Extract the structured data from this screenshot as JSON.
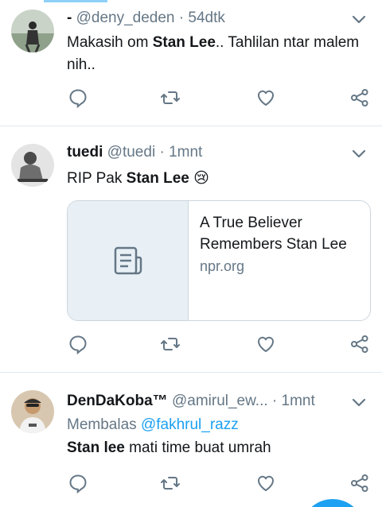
{
  "tweets": [
    {
      "prefix": "-",
      "name": "",
      "handle": "@deny_deden",
      "separator": "·",
      "time": "54dtk",
      "text_before": "Makasih om ",
      "text_bold": "Stan Lee",
      "text_after": ".. Tahlilan ntar malem nih..",
      "avatar_icon": "person-avatar"
    },
    {
      "name": "tuedi",
      "handle": "@tuedi",
      "separator": "·",
      "time": "1mnt",
      "text_before": "RIP Pak ",
      "text_bold": "Stan Lee",
      "text_after": " 😢",
      "card": {
        "title": "A True Believer Remembers Stan Lee",
        "domain": "npr.org",
        "thumb_icon": "article-icon"
      },
      "avatar_icon": "person-avatar"
    },
    {
      "name": "DenDaKoba™",
      "handle": "@amirul_ew...",
      "separator": "·",
      "time": "1mnt",
      "reply_label": "Membalas",
      "reply_mention": "@fakhrul_razz",
      "text_before": "",
      "text_bold": "Stan lee",
      "text_after": " mati time buat umrah",
      "avatar_icon": "person-avatar"
    }
  ],
  "actions": [
    "reply-icon",
    "retweet-icon",
    "like-icon",
    "share-icon"
  ],
  "colors": {
    "accent": "#1da1f2",
    "text": "#14171a",
    "secondary": "#657786",
    "icon": "#657786",
    "divider": "#e1e8ed"
  }
}
